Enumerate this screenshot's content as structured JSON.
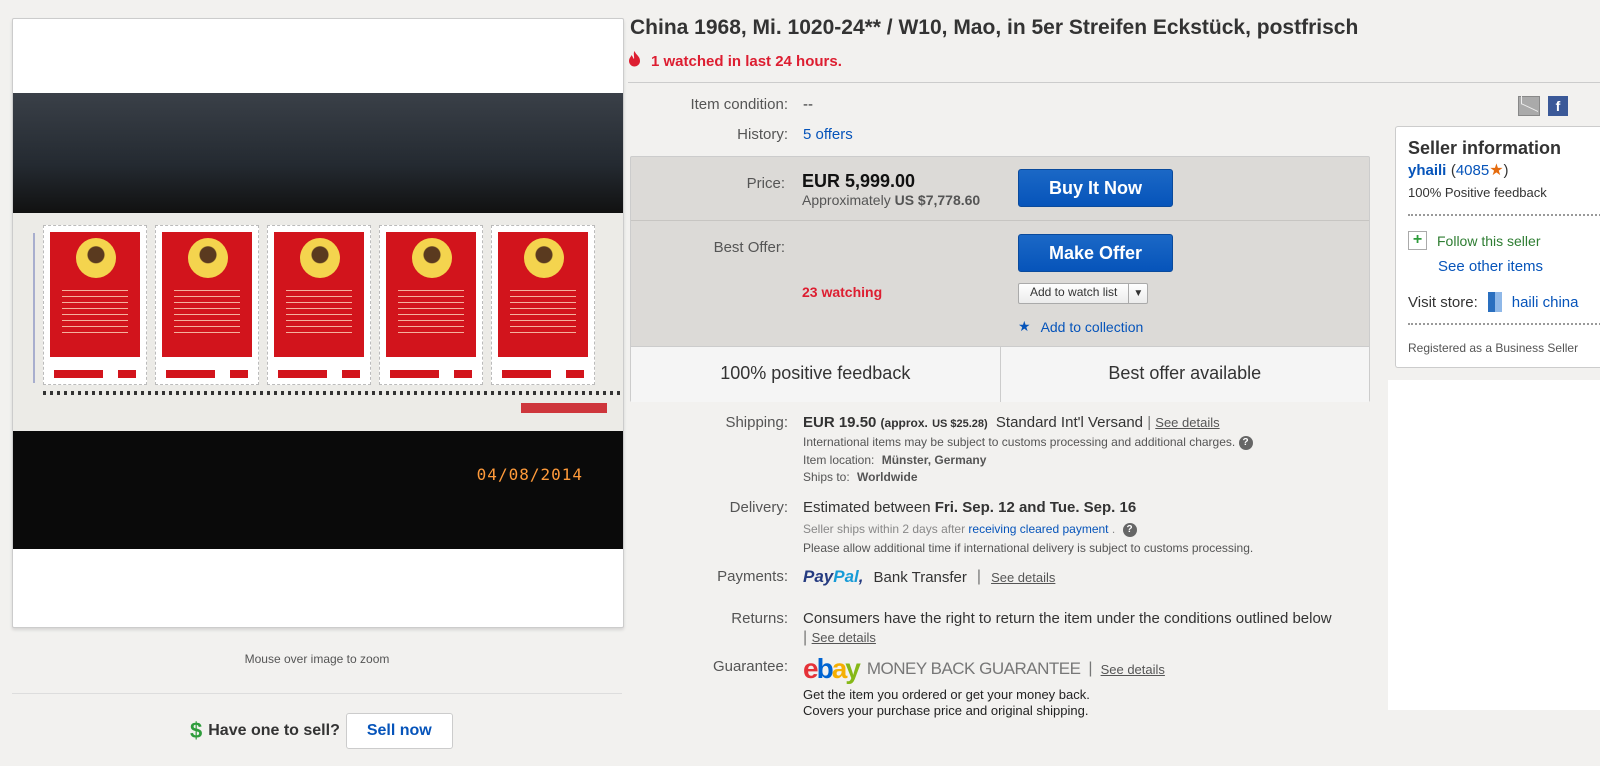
{
  "gallery": {
    "photo_date": "04/08/2014",
    "zoom_hint": "Mouse over image to zoom",
    "sell_prompt": "Have one to sell?",
    "sell_button": "Sell now"
  },
  "item": {
    "title": "China 1968, Mi. 1020-24** / W10, Mao, in 5er Streifen Eckstück, postfrisch",
    "watch_alert": "1 watched in last 24 hours.",
    "condition_label": "Item condition:",
    "condition_value": "--",
    "history_label": "History:",
    "history_value": "5 offers"
  },
  "price_box": {
    "price_label": "Price:",
    "price": "EUR 5,999.00",
    "approx_prefix": "Approximately",
    "approx_value": "US $7,778.60",
    "buy_now": "Buy It Now",
    "best_offer_label": "Best Offer:",
    "make_offer": "Make Offer",
    "watching": "23 watching",
    "watch_list": "Add to watch list",
    "add_collection": "Add to collection",
    "feature_left": "100% positive feedback",
    "feature_right": "Best offer available"
  },
  "shipping": {
    "label": "Shipping:",
    "cost": "EUR 19.50",
    "approx": "(approx.",
    "approx_value": "US $25.28)",
    "service": "Standard Int'l Versand",
    "see_details": "See details",
    "customs_note": "International items may be subject to customs processing and additional charges.",
    "location_label": "Item location:",
    "location_value": "Münster, Germany",
    "ships_to_label": "Ships to:",
    "ships_to_value": "Worldwide"
  },
  "delivery": {
    "label": "Delivery:",
    "prefix": "Estimated between",
    "range": "Fri. Sep. 12 and Tue. Sep. 16",
    "handling_prefix": "Seller ships within 2 days after",
    "handling_link": "receiving cleared payment",
    "handling_suffix": ".",
    "customs_note": "Please allow additional time if international delivery is subject to customs processing."
  },
  "payments": {
    "label": "Payments:",
    "paypal_a": "Pay",
    "paypal_b": "Pal",
    "other": "Bank Transfer",
    "see_details": "See details"
  },
  "returns": {
    "label": "Returns:",
    "text": "Consumers have the right to return the item under the conditions outlined below",
    "see_details": "See details"
  },
  "guarantee": {
    "label": "Guarantee:",
    "logo_e": "e",
    "logo_b": "b",
    "logo_a": "a",
    "logo_y": "y",
    "mbg": "MONEY BACK GUARANTEE",
    "see_details": "See details",
    "line1": "Get the item you ordered or get your money back.",
    "line2": "Covers your purchase price and original shipping."
  },
  "seller": {
    "title": "Seller information",
    "name": "yhaili",
    "score_open": "(",
    "score": "4085",
    "score_close": ")",
    "feedback": "100% Positive feedback",
    "follow": "Follow this seller",
    "see_other": "See other items",
    "visit_store": "Visit store:",
    "store_name": "haili china",
    "registered": "Registered as a Business Seller"
  },
  "colors": {
    "link": "#0654ba",
    "alert_red": "#dd1e31",
    "button_blue": "#0654ba",
    "stamp_red": "#d2141c"
  }
}
